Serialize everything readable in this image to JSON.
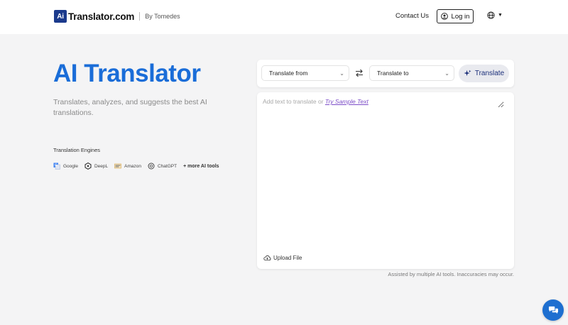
{
  "header": {
    "logo_mark": "Ai",
    "logo_text": "Translator.com",
    "by_text": "By Tomedes",
    "contact_label": "Contact Us",
    "login_label": "Log in",
    "language_icon": "globe-icon"
  },
  "hero": {
    "title": "AI Translator",
    "subtitle": "Translates, analyzes, and suggests the best AI translations."
  },
  "engines": {
    "title": "Translation Engines",
    "items": [
      {
        "label": "Google",
        "icon": "google-translate-icon"
      },
      {
        "label": "DeepL",
        "icon": "deepl-icon"
      },
      {
        "label": "Amazon",
        "icon": "amazon-icon"
      },
      {
        "label": "ChatGPT",
        "icon": "chatgpt-icon"
      }
    ],
    "more_label": "+ more AI tools"
  },
  "translator": {
    "from_label": "Translate from",
    "to_label": "Translate to",
    "translate_label": "Translate",
    "input_value": "",
    "placeholder_text": "Add text to translate or",
    "sample_link": "Try Sample Text",
    "upload_label": "Upload File",
    "disclaimer": "Assisted by multiple AI tools. Inaccuracies may occur."
  },
  "colors": {
    "accent": "#1a6dd8",
    "brand": "#1b3a8c",
    "link": "#7d4ec8",
    "chat": "#1e6fd0"
  }
}
